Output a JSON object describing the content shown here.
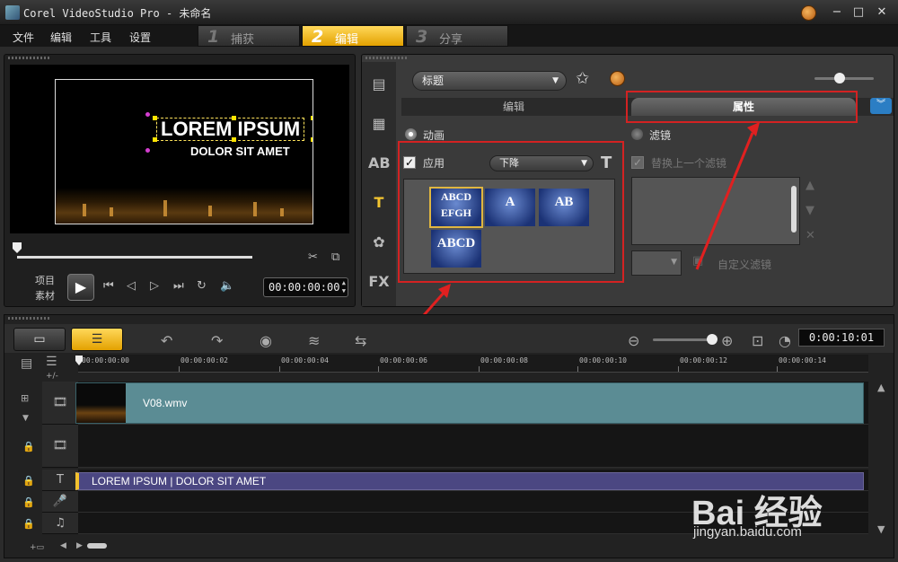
{
  "window": {
    "title": "Corel VideoStudio Pro - 未命名"
  },
  "menu": [
    "文件",
    "编辑",
    "工具",
    "设置"
  ],
  "steps": [
    {
      "num": "1",
      "label": "捕获"
    },
    {
      "num": "2",
      "label": "编辑"
    },
    {
      "num": "3",
      "label": "分享"
    }
  ],
  "preview": {
    "title_line1": "LOREM IPSUM",
    "title_line2": "DOLOR SIT AMET",
    "mode_project": "项目",
    "mode_clip": "素材",
    "timecode": "00:00:00:00"
  },
  "options": {
    "category": "标题",
    "tab_edit": "编辑",
    "tab_attributes": "属性",
    "animation_label": "动画",
    "apply_label": "应用",
    "animation_type": "下降",
    "filter_label": "滤镜",
    "replace_filter_label": "替换上一个滤镜",
    "custom_filter_label": "自定义滤镜",
    "presets": [
      "ABCD EFGH",
      "A",
      "AB",
      "ABCD"
    ]
  },
  "timeline": {
    "timecode": "0:00:10:01",
    "ruler": [
      "00:00:00:00",
      "00:00:00:02",
      "00:00:00:04",
      "00:00:00:06",
      "00:00:00:08",
      "00:00:00:10",
      "00:00:00:12",
      "00:00:00:14"
    ],
    "video_clip_name": "V08.wmv",
    "title_clip_name": "LOREM IPSUM | DOLOR SIT AMET",
    "zoom_control": "+/-"
  },
  "watermark": {
    "brand": "Bai 经验",
    "url": "jingyan.baidu.com"
  },
  "colors": {
    "accent": "#e3a100",
    "annotation": "#d32222",
    "video_clip": "#5b8c94",
    "title_clip": "#4b4782"
  }
}
